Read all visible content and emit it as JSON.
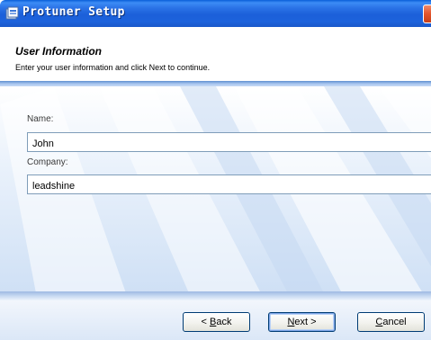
{
  "window": {
    "title": "Protuner Setup"
  },
  "header": {
    "title": "User Information",
    "subtitle": "Enter your user information and click Next to continue."
  },
  "form": {
    "name_label": "Name:",
    "name_value": "John",
    "company_label": "Company:",
    "company_value": "leadshine"
  },
  "buttons": {
    "back": {
      "prefix": "< ",
      "accel": "B",
      "rest": "ack"
    },
    "next": {
      "accel": "N",
      "rest": "ext >"
    },
    "cancel": {
      "accel": "C",
      "rest": "ancel"
    }
  },
  "icons": {
    "app": "setup-app-icon",
    "close": "close-icon"
  },
  "colors": {
    "titlebar": "#1b5fd9",
    "close": "#e2542c",
    "field_border": "#7f9db9",
    "button_border": "#003c74"
  }
}
